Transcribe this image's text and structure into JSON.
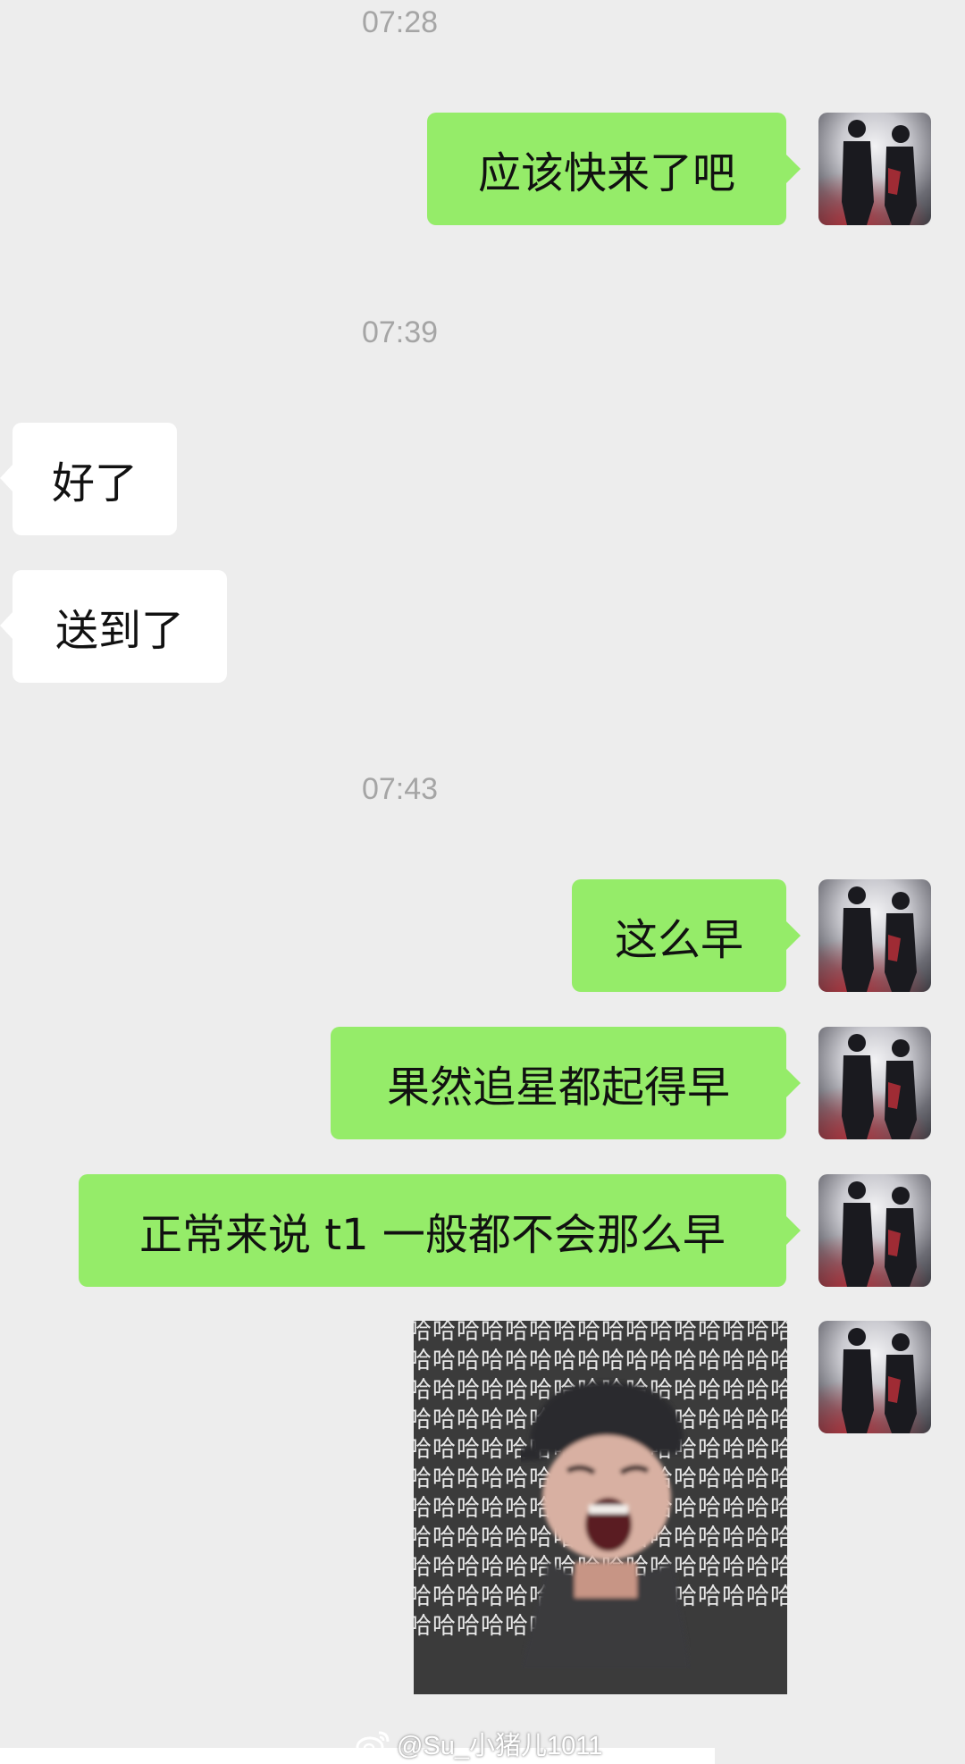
{
  "chat": {
    "timestamps": [
      "07:28",
      "07:39",
      "07:43"
    ],
    "messages": [
      {
        "sender": "me",
        "text": "应该快来了吧"
      },
      {
        "sender": "other",
        "text": "好了"
      },
      {
        "sender": "other",
        "text": "送到了"
      },
      {
        "sender": "me",
        "text": "这么早"
      },
      {
        "sender": "me",
        "text": "果然追星都起得早"
      },
      {
        "sender": "me",
        "text": "正常来说 t1 一般都不会那么早"
      }
    ],
    "image_message": {
      "pattern_text": "哈哈哈哈哈哈哈哈哈哈哈哈哈哈哈哈哈哈哈哈哈哈哈哈哈哈哈哈哈哈哈哈哈哈哈哈哈哈哈哈哈哈哈哈哈哈哈哈哈哈哈哈哈哈哈哈哈哈哈哈哈哈哈哈哈哈哈哈哈哈哈哈哈哈哈哈哈哈哈哈哈哈哈哈哈哈哈哈哈哈哈哈哈哈哈哈哈哈哈哈哈哈哈哈哈哈哈哈哈哈哈哈哈哈哈哈哈哈哈哈哈哈哈哈哈哈哈哈哈哈哈哈哈哈哈哈哈哈哈哈哈哈哈哈哈哈哈哈哈哈哈哈哈哈哈哈哈哈哈哈哈哈哈哈哈哈哈哈"
    }
  },
  "colors": {
    "background": "#ededed",
    "sent_bubble": "#95ec69",
    "received_bubble": "#ffffff",
    "timestamp_text": "#a5a5a5"
  },
  "watermark": {
    "text": "@Su_小猪儿1011",
    "icon": "weibo-logo-icon"
  }
}
